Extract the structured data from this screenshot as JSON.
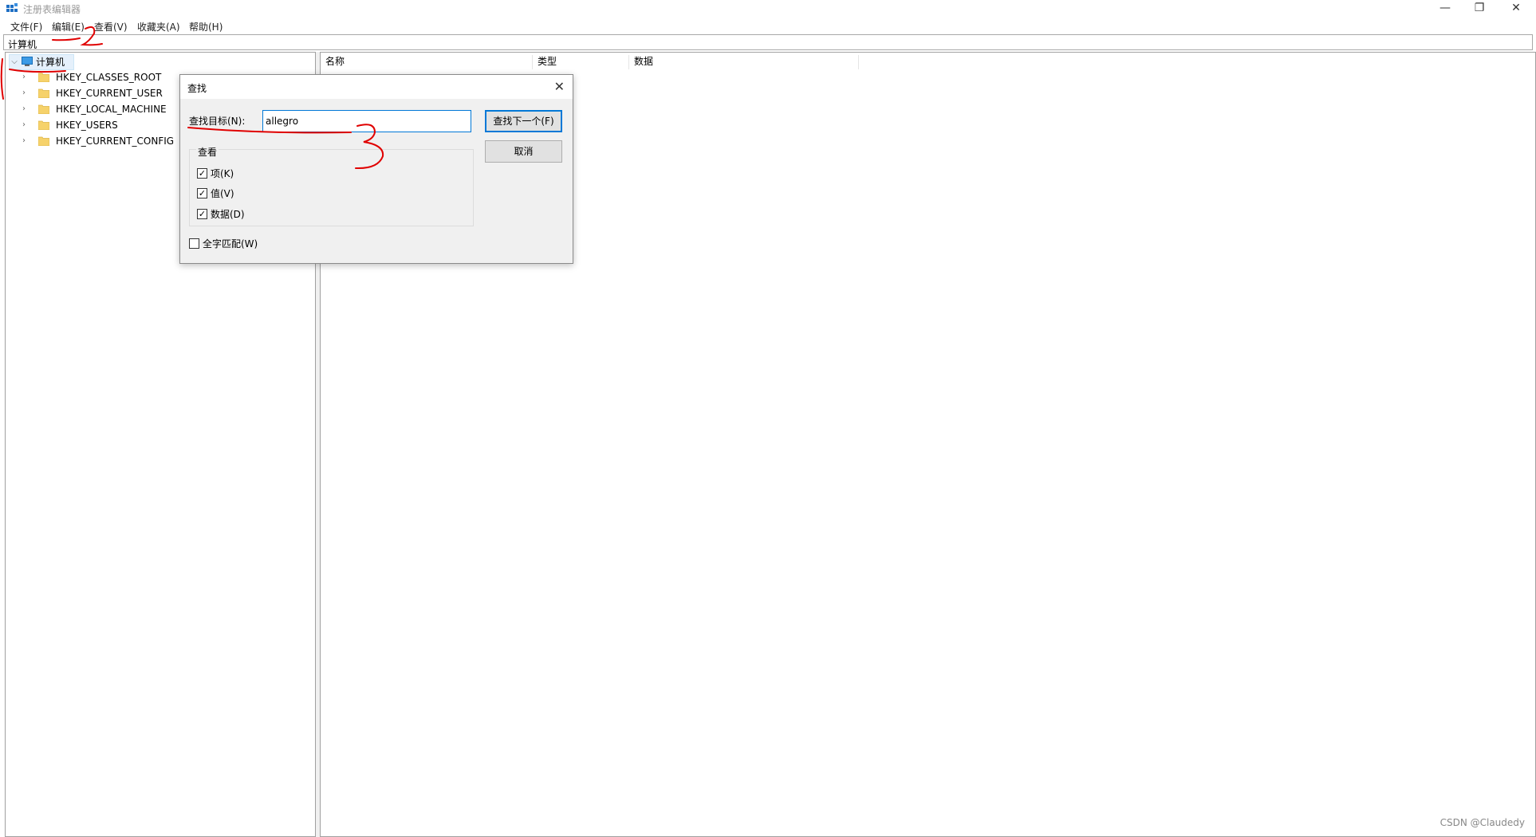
{
  "window": {
    "title": "注册表编辑器",
    "minimize": "—",
    "restore": "❐",
    "close": "✕"
  },
  "menu": [
    "文件(F)",
    "编辑(E)",
    "查看(V)",
    "收藏夹(A)",
    "帮助(H)"
  ],
  "address": "计算机",
  "columns": [
    "名称",
    "类型",
    "数据"
  ],
  "tree": {
    "root": "计算机",
    "children": [
      "HKEY_CLASSES_ROOT",
      "HKEY_CURRENT_USER",
      "HKEY_LOCAL_MACHINE",
      "HKEY_USERS",
      "HKEY_CURRENT_CONFIG"
    ]
  },
  "find_dialog": {
    "title": "查找",
    "find_what_label": "查找目标(N):",
    "find_what_value": "allegro",
    "find_next_button": "查找下一个(F)",
    "cancel_button": "取消",
    "look_at_title": "查看",
    "options": [
      {
        "label": "项(K)",
        "checked": true
      },
      {
        "label": "值(V)",
        "checked": true
      },
      {
        "label": "数据(D)",
        "checked": true
      }
    ],
    "match_whole": {
      "label": "全字匹配(W)",
      "checked": false
    }
  },
  "watermark": "CSDN @Claudedy",
  "colors": {
    "annotation": "#e00000",
    "accent": "#0078d7"
  }
}
